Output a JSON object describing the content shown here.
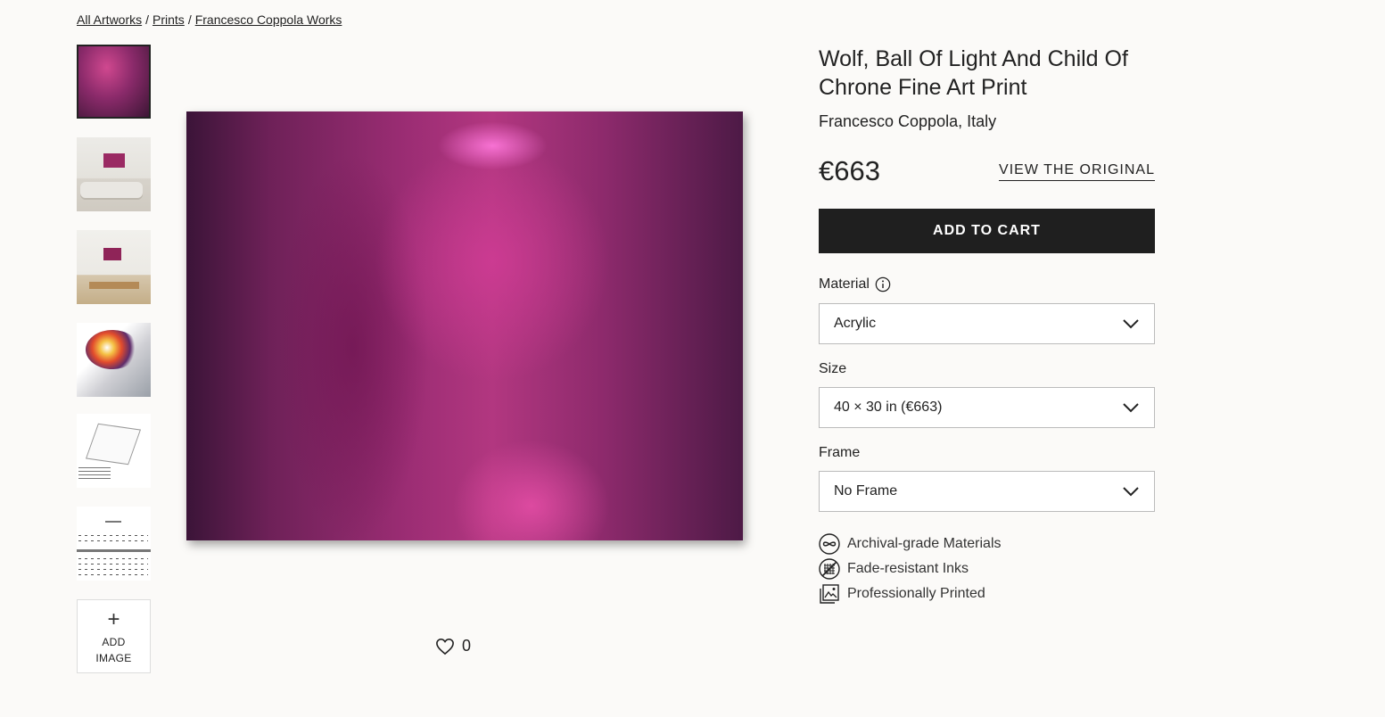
{
  "breadcrumb": {
    "items": [
      "All Artworks",
      "Prints",
      "Francesco Coppola Works"
    ],
    "separator": "/"
  },
  "thumbnails": [
    {
      "name": "artwork-thumbnail",
      "active": true
    },
    {
      "name": "living-room-mockup-thumbnail"
    },
    {
      "name": "dining-room-mockup-thumbnail"
    },
    {
      "name": "acrylic-sample-thumbnail"
    },
    {
      "name": "frame-diagram-thumbnail"
    },
    {
      "name": "size-chart-thumbnail"
    }
  ],
  "add_image": {
    "icon": "plus-icon",
    "line1": "ADD",
    "line2": "IMAGE"
  },
  "likes": {
    "icon": "heart-icon",
    "count": "0"
  },
  "product": {
    "title_line1": "Wolf, Ball Of Light And Child Of",
    "title_line2": "Chrone Fine Art Print",
    "artist": "Francesco Coppola, Italy",
    "price": "€663",
    "view_original": "VIEW THE ORIGINAL",
    "add_to_cart": "ADD TO CART"
  },
  "options": {
    "material": {
      "label": "Material",
      "value": "Acrylic",
      "info_icon": "info-icon"
    },
    "size": {
      "label": "Size",
      "value": "40 × 30 in (€663)"
    },
    "frame": {
      "label": "Frame",
      "value": "No Frame"
    }
  },
  "features": [
    {
      "icon": "infinity-icon",
      "label": "Archival-grade Materials"
    },
    {
      "icon": "fade-resistant-icon",
      "label": "Fade-resistant Inks"
    },
    {
      "icon": "print-icon",
      "label": "Professionally Printed"
    }
  ],
  "colors": {
    "background": "#fbfaf8",
    "button": "#1f1f1f",
    "text": "#222222"
  }
}
